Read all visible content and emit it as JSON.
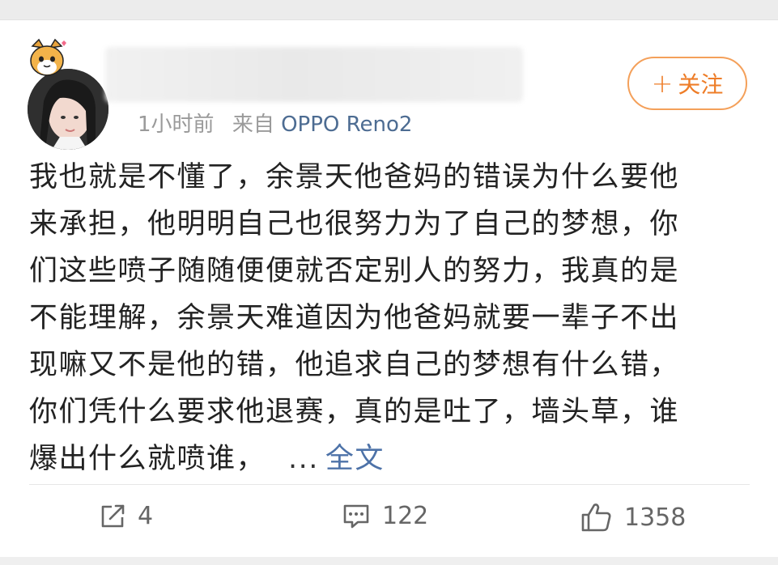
{
  "post": {
    "username": "",
    "time": "1小时前",
    "source_prefix": "来自",
    "source_device": "OPPO Reno2",
    "follow_label": "关注",
    "follow_plus": "+",
    "text_lines": [
      "我也就是不懂了，余景天他爸妈的错误为什么要他",
      "来承担，他明明自己也很努力为了自己的梦想，你",
      "们这些喷子随随便便就否定别人的努力，我真的是",
      "不能理解，余景天难道因为他爸妈就要一辈子不出",
      "现嘛又不是他的错，他追求自己的梦想有什么错，",
      "你们凭什么要求他退赛，真的是吐了，墙头草，谁",
      "爆出什么就喷谁，"
    ],
    "ellipsis": "...",
    "full_text_link": "全文"
  },
  "actions": {
    "repost": {
      "icon": "repost-icon",
      "count": "4"
    },
    "comment": {
      "icon": "comment-icon",
      "count": "122"
    },
    "like": {
      "icon": "thumbs-up-icon",
      "count": "1358"
    }
  },
  "colors": {
    "accent_orange": "#ee7d28",
    "link_blue": "#4d72a8",
    "meta_gray": "#9a9a9a",
    "text": "#222222"
  }
}
